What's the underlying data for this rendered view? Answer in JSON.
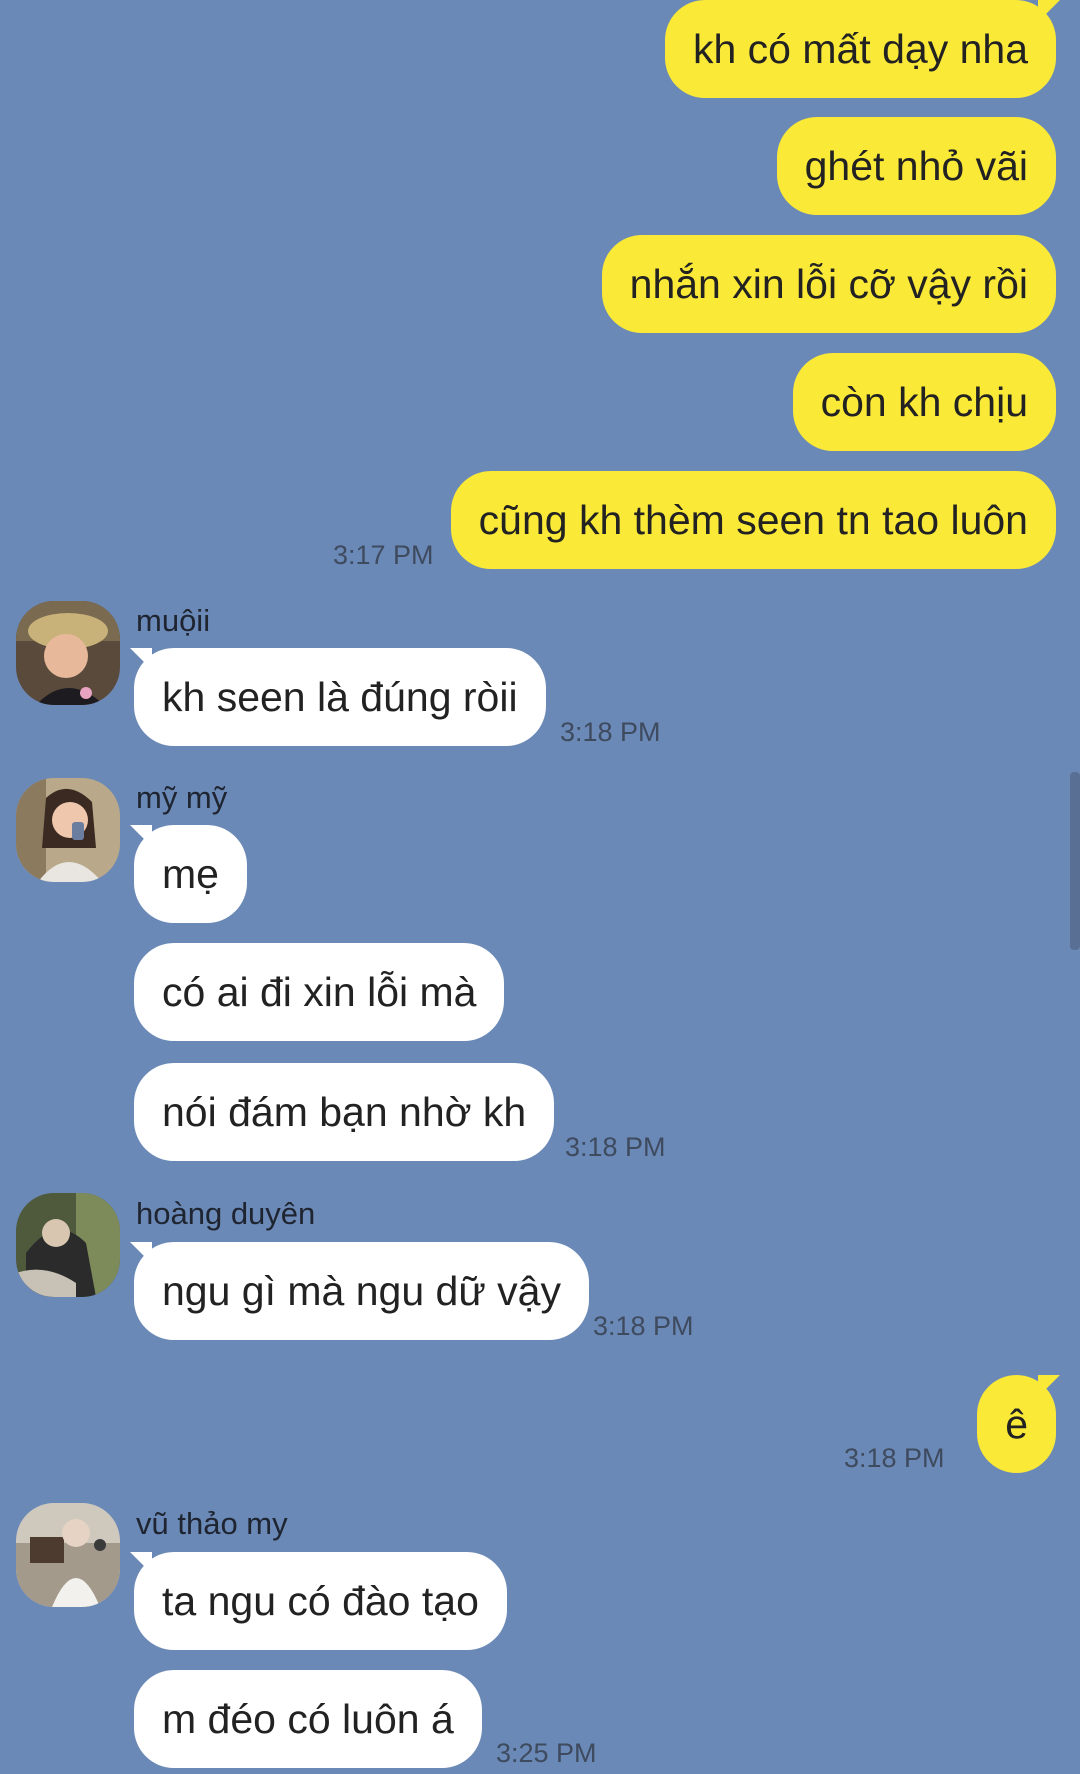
{
  "colors": {
    "background": "#6b89b7",
    "outgoing_bubble": "#fbe938",
    "incoming_bubble": "#ffffff",
    "timestamp": "#3e4a5e"
  },
  "messages": {
    "out1": "kh có mất dạy nha",
    "out2": "ghét nhỏ vãi",
    "out3": "nhắn xin lỗi cỡ vậy rồi",
    "out4": "còn kh chịu",
    "out5": "cũng kh thèm seen tn tao luôn",
    "out5_time": "3:17 PM",
    "g1_name": "muộii",
    "g1_m1": "kh seen là đúng ròii",
    "g1_time": "3:18 PM",
    "g2_name": "mỹ mỹ",
    "g2_m1": "mẹ",
    "g2_m2": "có ai đi xin lỗi mà",
    "g2_m3": "nói đám bạn nhờ kh",
    "g2_time": "3:18 PM",
    "g3_name": "hoàng duyên",
    "g3_m1": "ngu gì mà ngu dữ vậy",
    "g3_time": "3:18 PM",
    "out6": "ê",
    "out6_time": "3:18 PM",
    "g4_name": "vũ thảo my",
    "g4_m1": "ta ngu có đào tạo",
    "g4_m2": "m đéo có luôn á",
    "g4_time": "3:25 PM"
  },
  "avatars": {
    "g1": "profile-photo-avatar",
    "g2": "profile-photo-avatar",
    "g3": "profile-photo-avatar",
    "g4": "profile-photo-avatar"
  }
}
